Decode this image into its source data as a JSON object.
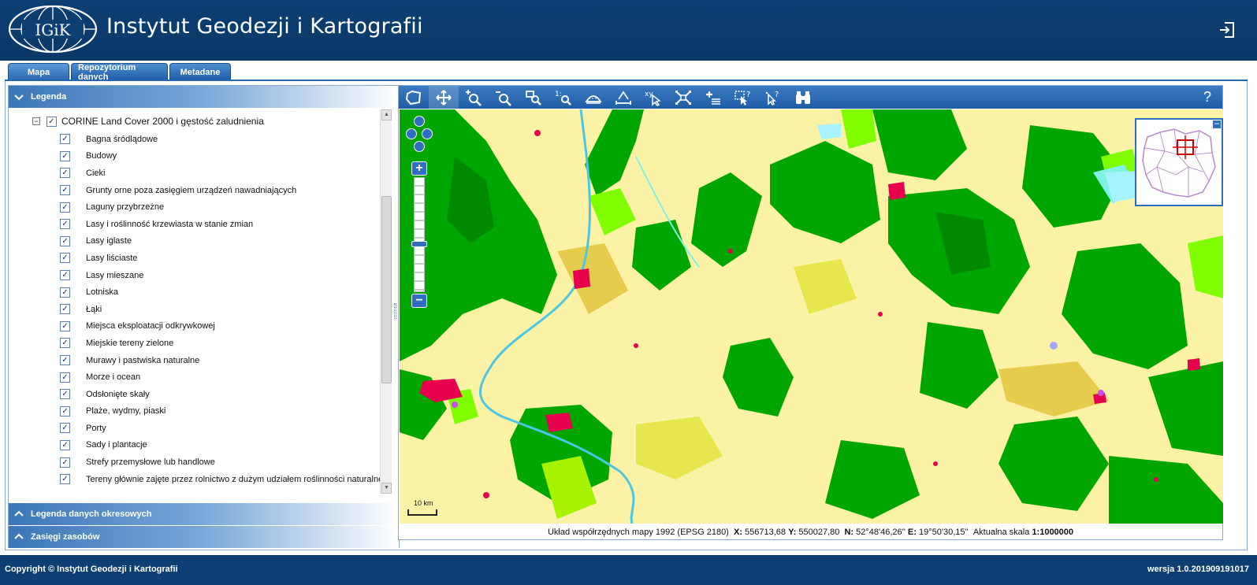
{
  "header": {
    "logo_text": "IGiK",
    "title": "Instytut Geodezji i Kartografii",
    "logout_icon": "logout-icon"
  },
  "tabs": [
    {
      "label": "Mapa",
      "active": true
    },
    {
      "label": "Repozytorium danych",
      "active": false
    },
    {
      "label": "Metadane",
      "active": false
    }
  ],
  "left_panel": {
    "legend_header": "Legenda",
    "root_layer": {
      "label": "CORINE Land Cover 2000 i gęstość zaludnienia",
      "checked": true
    },
    "items": [
      {
        "label": "Bagna śródlądowe",
        "checked": true
      },
      {
        "label": "Budowy",
        "checked": true
      },
      {
        "label": "Cieki",
        "checked": true
      },
      {
        "label": "Grunty orne poza zasięgiem urządzeń nawadniających",
        "checked": true
      },
      {
        "label": "Laguny przybrzeżne",
        "checked": true
      },
      {
        "label": "Lasy i roślinność krzewiasta w stanie zmian",
        "checked": true
      },
      {
        "label": "Lasy iglaste",
        "checked": true
      },
      {
        "label": "Lasy liściaste",
        "checked": true
      },
      {
        "label": "Lasy mieszane",
        "checked": true
      },
      {
        "label": "Lotniska",
        "checked": true
      },
      {
        "label": "Łąki",
        "checked": true
      },
      {
        "label": "Miejsca eksploatacji odkrywkowej",
        "checked": true
      },
      {
        "label": "Miejskie tereny zielone",
        "checked": true
      },
      {
        "label": "Murawy i pastwiska naturalne",
        "checked": true
      },
      {
        "label": "Morze i ocean",
        "checked": true
      },
      {
        "label": "Odsłonięte skały",
        "checked": true
      },
      {
        "label": "Plaże, wydmy, piaski",
        "checked": true
      },
      {
        "label": "Porty",
        "checked": true
      },
      {
        "label": "Sady i plantacje",
        "checked": true
      },
      {
        "label": "Strefy przemysłowe lub handlowe",
        "checked": true
      },
      {
        "label": "Tereny głównie zajęte przez rolnictwo z dużym udziałem roślinności naturalnej",
        "checked": true
      }
    ],
    "periodic_header": "Legenda danych okresowych",
    "extent_header": "Zasięgi zasobów"
  },
  "toolbar": {
    "tools": [
      {
        "name": "select-area-polygon-icon",
        "active": false
      },
      {
        "name": "pan-icon",
        "active": true
      },
      {
        "name": "zoom-in-icon",
        "active": false
      },
      {
        "name": "zoom-out-icon",
        "active": false
      },
      {
        "name": "zoom-box-icon",
        "active": false
      },
      {
        "name": "zoom-1-to-1-icon",
        "active": false
      },
      {
        "name": "measure-area-icon",
        "active": false
      },
      {
        "name": "measure-distance-icon",
        "active": false
      },
      {
        "name": "coordinates-xy-icon",
        "active": false
      },
      {
        "name": "full-extent-icon",
        "active": false
      },
      {
        "name": "add-layer-icon",
        "active": false
      },
      {
        "name": "identify-area-icon",
        "active": false
      },
      {
        "name": "identify-point-icon",
        "active": false
      },
      {
        "name": "search-binoculars-icon",
        "active": false
      }
    ],
    "help_label": "?"
  },
  "map": {
    "scale_bar_label": "10 km",
    "zoom_plus": "+",
    "zoom_minus": "−",
    "zoom_level": 0.42,
    "overview_toggle": "−",
    "colors": {
      "arable": "#fbf2a6",
      "forest": "#00a600",
      "broadleaf": "#80ff00",
      "agri_mixed": "#e6cc4d",
      "urban": "#e6004d",
      "water": "#80f2e6",
      "wetland": "#a6a6ff"
    }
  },
  "status": {
    "prefix": "Układ współrzędnych mapy 1992 (EPSG 2180)",
    "x_label": "X:",
    "x_value": "556713,68",
    "y_label": "Y:",
    "y_value": "550027,80",
    "n_label": "N:",
    "n_value": "52°48'46,26''",
    "e_label": "E:",
    "e_value": "19°50'30,15''",
    "scale_label": "Aktualna skala",
    "scale_value": "1:1000000"
  },
  "footer": {
    "copyright": "Copyright © Instytut Geodezji i Kartografii",
    "version": "wersja 1.0.201909191017"
  }
}
